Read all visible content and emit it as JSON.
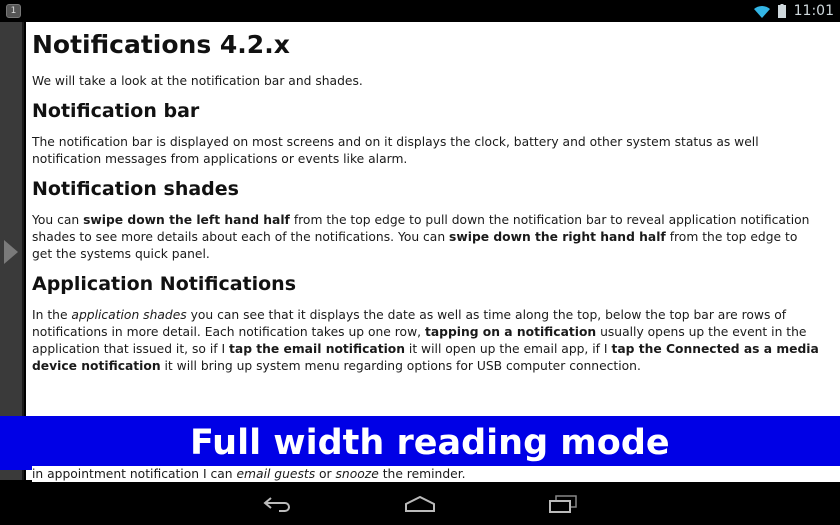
{
  "status_bar": {
    "notification_icon": "1",
    "clock": "11:01",
    "icons": [
      "wifi-icon",
      "battery-icon"
    ]
  },
  "article": {
    "title": "Notifications 4.2.x",
    "intro": "We will take a look at the notification bar and shades.",
    "sections": [
      {
        "heading": "Notification bar",
        "paragraph": [
          {
            "t": "The notification bar is displayed on most screens and on it displays the clock, battery and other system status as well notification messages from applications or events like alarm."
          }
        ]
      },
      {
        "heading": "Notification shades",
        "paragraph": [
          {
            "t": "You can "
          },
          {
            "b": "swipe down the left hand half"
          },
          {
            "t": " from the top edge to pull down the notification bar to reveal application notification shades to see more details about each of the notifications. You can "
          },
          {
            "b": "swipe down the right hand half"
          },
          {
            "t": " from the top edge to get the systems quick panel."
          }
        ]
      },
      {
        "heading": "Application Notifications",
        "paragraph": [
          {
            "t": "In the "
          },
          {
            "i": "application shades"
          },
          {
            "t": " you can see that it displays the date as well as time along the top, below the top bar are rows of notifications in more detail. Each notification takes up one row, "
          },
          {
            "b": "tapping on a notification"
          },
          {
            "t": " usually opens up the event in the application that issued it, so if I "
          },
          {
            "b": "tap the email notification"
          },
          {
            "t": " it will open up the email app, if I "
          },
          {
            "b": "tap the Connected as a media device notification"
          },
          {
            "t": " it will bring up system menu regarding options for USB computer connection."
          }
        ]
      }
    ],
    "tail_line": [
      {
        "t": "in appointment notification I can "
      },
      {
        "i": "email guests"
      },
      {
        "t": " or "
      },
      {
        "i": "snooze"
      },
      {
        "t": " the reminder."
      }
    ]
  },
  "banner": {
    "text": "Full width reading mode",
    "background": "#0000e6"
  },
  "nav_bar": {
    "buttons": [
      "back-icon",
      "home-icon",
      "recent-apps-icon"
    ]
  }
}
